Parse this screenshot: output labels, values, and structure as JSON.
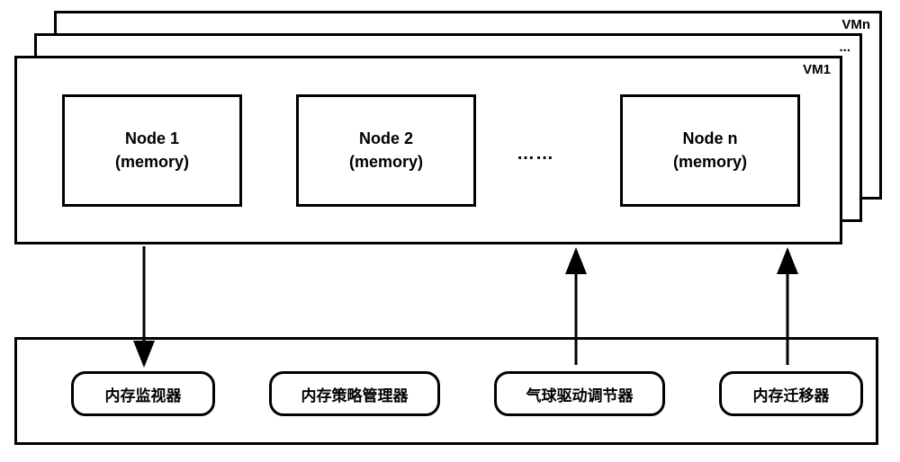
{
  "vm_labels": {
    "back": "VMn",
    "mid": "...",
    "front": "VM1"
  },
  "nodes": {
    "n1": {
      "title": "Node 1",
      "sub": "(memory)"
    },
    "n2": {
      "title": "Node 2",
      "sub": "(memory)"
    },
    "nn": {
      "title": "Node n",
      "sub": "(memory)"
    },
    "ellipsis": "……"
  },
  "modules": {
    "m1": "内存监视器",
    "m2": "内存策略管理器",
    "m3": "气球驱动调节器",
    "m4": "内存迁移器"
  }
}
